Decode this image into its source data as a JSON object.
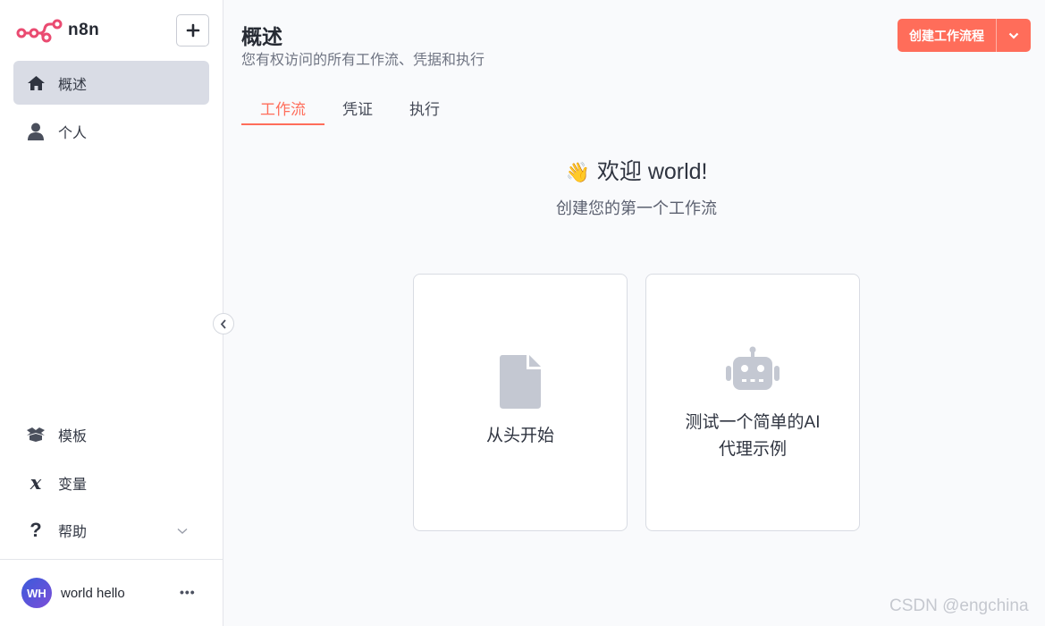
{
  "app": {
    "name": "n8n"
  },
  "sidebar": {
    "items": [
      {
        "label": "概述",
        "icon": "home-icon",
        "active": true
      },
      {
        "label": "个人",
        "icon": "user-icon",
        "active": false
      }
    ],
    "bottom_items": [
      {
        "label": "模板",
        "icon": "box-open-icon"
      },
      {
        "label": "变量",
        "icon": "variable-icon"
      },
      {
        "label": "帮助",
        "icon": "question-icon"
      }
    ],
    "user": {
      "initials": "WH",
      "name": "world hello"
    }
  },
  "header": {
    "title": "概述",
    "subtitle": "您有权访问的所有工作流、凭据和执行",
    "create_label": "创建工作流程"
  },
  "tabs": [
    {
      "label": "工作流",
      "active": true
    },
    {
      "label": "凭证",
      "active": false
    },
    {
      "label": "执行",
      "active": false
    }
  ],
  "welcome": {
    "emoji": "👋",
    "title": "欢迎 world!",
    "subtitle": "创建您的第一个工作流"
  },
  "cards": [
    {
      "label": "从头开始",
      "icon": "file-icon"
    },
    {
      "label_line1": "测试一个简单的AI",
      "label_line2": "代理示例",
      "icon": "robot-icon"
    }
  ],
  "watermark": "CSDN @engchina",
  "colors": {
    "accent": "#ff6d5a",
    "active_nav_bg": "#d9dce5",
    "icon_gray": "#c4c8d2"
  }
}
